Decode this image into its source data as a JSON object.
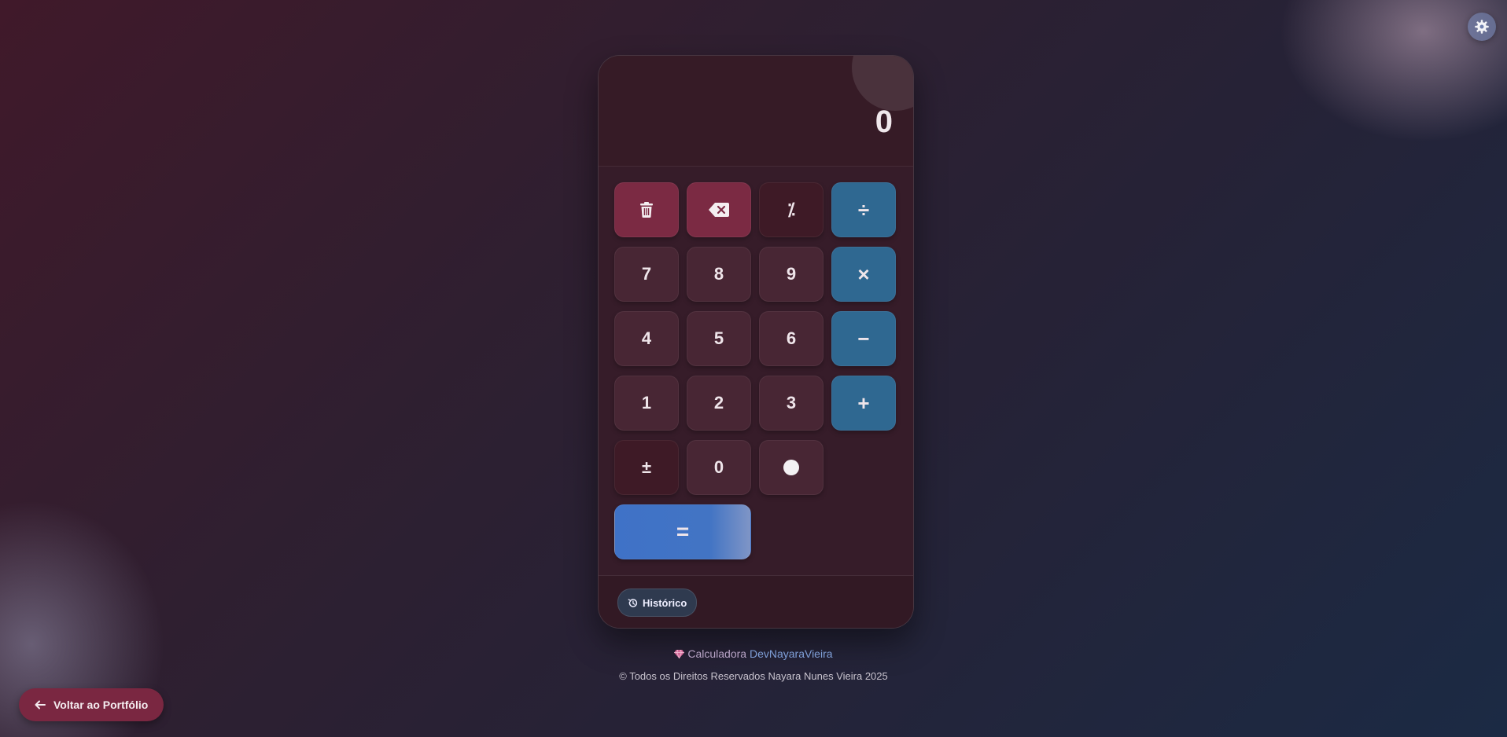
{
  "display": {
    "value": "0"
  },
  "keys": {
    "clear": "trash-icon",
    "backspace": "backspace-icon",
    "percent": "⁒",
    "divide": "÷",
    "seven": "7",
    "eight": "8",
    "nine": "9",
    "multiply": "×",
    "four": "4",
    "five": "5",
    "six": "6",
    "minus": "−",
    "one": "1",
    "two": "2",
    "three": "3",
    "plus": "+",
    "plus_minus": "±",
    "zero": "0",
    "decimal": "dot-icon",
    "equals": "="
  },
  "history": {
    "label": "Histórico",
    "icon": "history-icon"
  },
  "footer": {
    "credit_prefix": "Calculadora",
    "credit_brand": "DevNayaraVieira",
    "copyright": "© Todos os Direitos Reservados Nayara Nunes Vieira 2025"
  },
  "back_button": {
    "label": "Voltar ao Portfólio",
    "icon": "arrow-left-icon"
  },
  "theme_toggle": {
    "icon": "gear-icon"
  },
  "colors": {
    "danger": "#7b2a43",
    "operator": "#2f6891",
    "equals": "#3f72c7",
    "number": "#482634"
  }
}
